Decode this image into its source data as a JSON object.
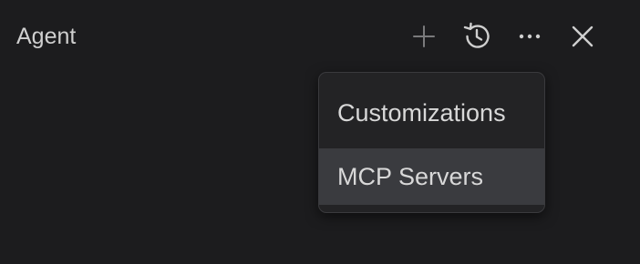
{
  "panel": {
    "title": "Agent"
  },
  "toolbar": {
    "icons": [
      "plus-icon",
      "history-icon",
      "more-icon",
      "close-icon"
    ]
  },
  "menu": {
    "items": [
      {
        "label": "Customizations"
      },
      {
        "label": "MCP Servers",
        "highlighted": true
      }
    ]
  },
  "colors": {
    "background": "#1c1c1e",
    "menu_background": "#232325",
    "menu_highlight": "#3a3b3f",
    "text": "#d8d8d8",
    "icon": "#cfcfcf",
    "icon_dimmed": "#7a7a7c"
  }
}
